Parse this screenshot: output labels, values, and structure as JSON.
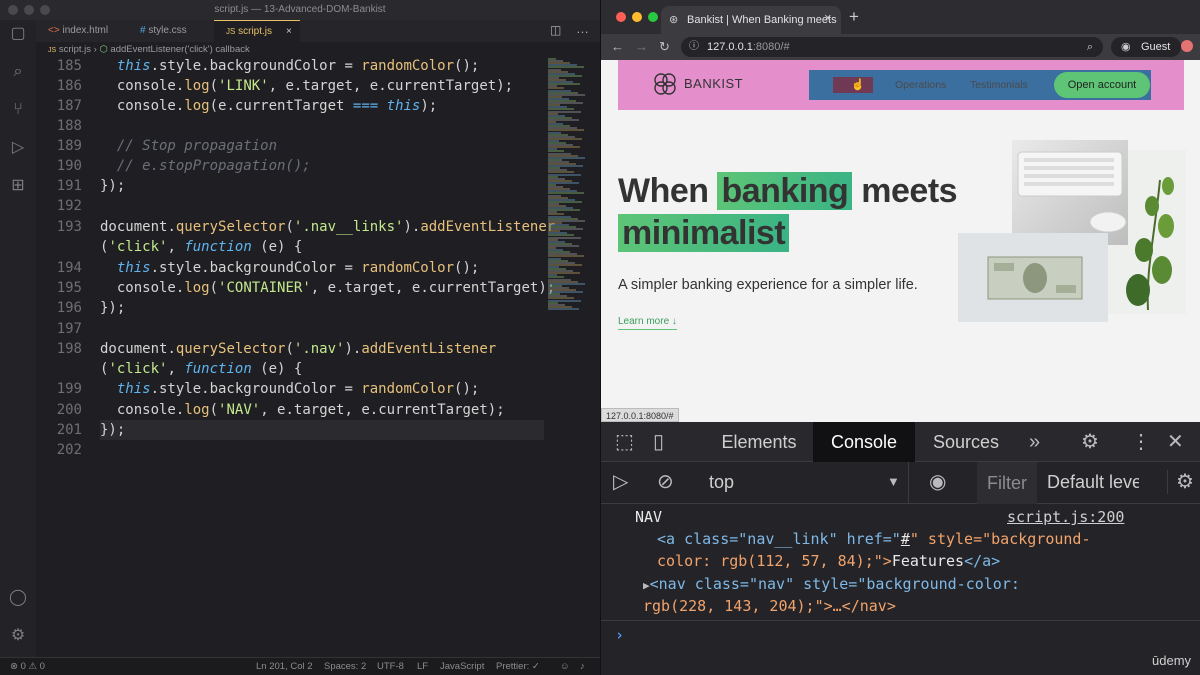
{
  "vscode": {
    "window_title": "script.js — 13-Advanced-DOM-Bankist",
    "tabs": [
      {
        "label": "index.html",
        "icon": "html-icon",
        "active": false
      },
      {
        "label": "style.css",
        "icon": "css-icon",
        "active": false
      },
      {
        "label": "script.js",
        "icon": "js-icon",
        "active": true
      }
    ],
    "breadcrumb": {
      "file": "script.js",
      "symbol": "addEventListener('click') callback"
    },
    "code": [
      {
        "num": "185",
        "text": "  this.style.backgroundColor = randomColor();"
      },
      {
        "num": "186",
        "text": "  console.log('LINK', e.target, e.currentTarget);"
      },
      {
        "num": "187",
        "text": "  console.log(e.currentTarget === this);"
      },
      {
        "num": "188",
        "text": ""
      },
      {
        "num": "189",
        "text": "  // Stop propagation"
      },
      {
        "num": "190",
        "text": "  // e.stopPropagation();"
      },
      {
        "num": "191",
        "text": "});"
      },
      {
        "num": "192",
        "text": ""
      },
      {
        "num": "193",
        "text": "document.querySelector('.nav__links').addEventListener"
      },
      {
        "num": "",
        "text": "('click', function (e) {"
      },
      {
        "num": "194",
        "text": "  this.style.backgroundColor = randomColor();"
      },
      {
        "num": "195",
        "text": "  console.log('CONTAINER', e.target, e.currentTarget);"
      },
      {
        "num": "196",
        "text": "});"
      },
      {
        "num": "197",
        "text": ""
      },
      {
        "num": "198",
        "text": "document.querySelector('.nav').addEventListener"
      },
      {
        "num": "",
        "text": "('click', function (e) {"
      },
      {
        "num": "199",
        "text": "  this.style.backgroundColor = randomColor();"
      },
      {
        "num": "200",
        "text": "  console.log('NAV', e.target, e.currentTarget);"
      },
      {
        "num": "201",
        "text": "});"
      },
      {
        "num": "202",
        "text": ""
      }
    ],
    "status": {
      "problems": "⊗ 0 ⚠ 0",
      "position": "Ln 201, Col 2",
      "spaces": "Spaces: 2",
      "encoding": "UTF-8",
      "eol": "LF",
      "language": "JavaScript",
      "prettier": "Prettier: ✓"
    }
  },
  "browser": {
    "tab_title": "Bankist | When Banking meets",
    "url_host": "127.0.0.1",
    "url_rest": ":8080/#",
    "profile": "Guest",
    "status_url": "127.0.0.1:8080/#",
    "page": {
      "brand": "BANKIST",
      "nav_links": [
        "Features",
        "Operations",
        "Testimonials"
      ],
      "cta": "Open account",
      "hero_line1_a": "When ",
      "hero_line1_hl": "banking",
      "hero_line1_b": " meets",
      "hero_line2_hl": "minimalist",
      "hero_sub": "A simpler banking experience for a simpler life.",
      "learn_more": "Learn more ↓"
    },
    "devtools": {
      "tabs": [
        "Elements",
        "Console",
        "Sources"
      ],
      "active_tab": "Console",
      "context": "top",
      "filter_placeholder": "Filter",
      "levels": "Default leve",
      "log_label": "NAV",
      "log_source": "script.js:200",
      "el1_open": "<a class=\"nav__link\" href=\"",
      "el1_href": "#",
      "el1_style_a": "\" style=\"background-",
      "el1_style_b": "color: rgb(112, 57, 84);\">",
      "el1_text": "Features",
      "el1_close": "</a>",
      "el2_a": "<nav class=\"nav\" style=\"background-color:",
      "el2_b": "rgb(228, 143, 204);\">…</nav>",
      "prompt": "›"
    }
  },
  "watermark": "ūdemy",
  "colors": {
    "nav_bg": "#e48fcc",
    "link_bg": "#703954",
    "accent_green": "#5ec576"
  }
}
